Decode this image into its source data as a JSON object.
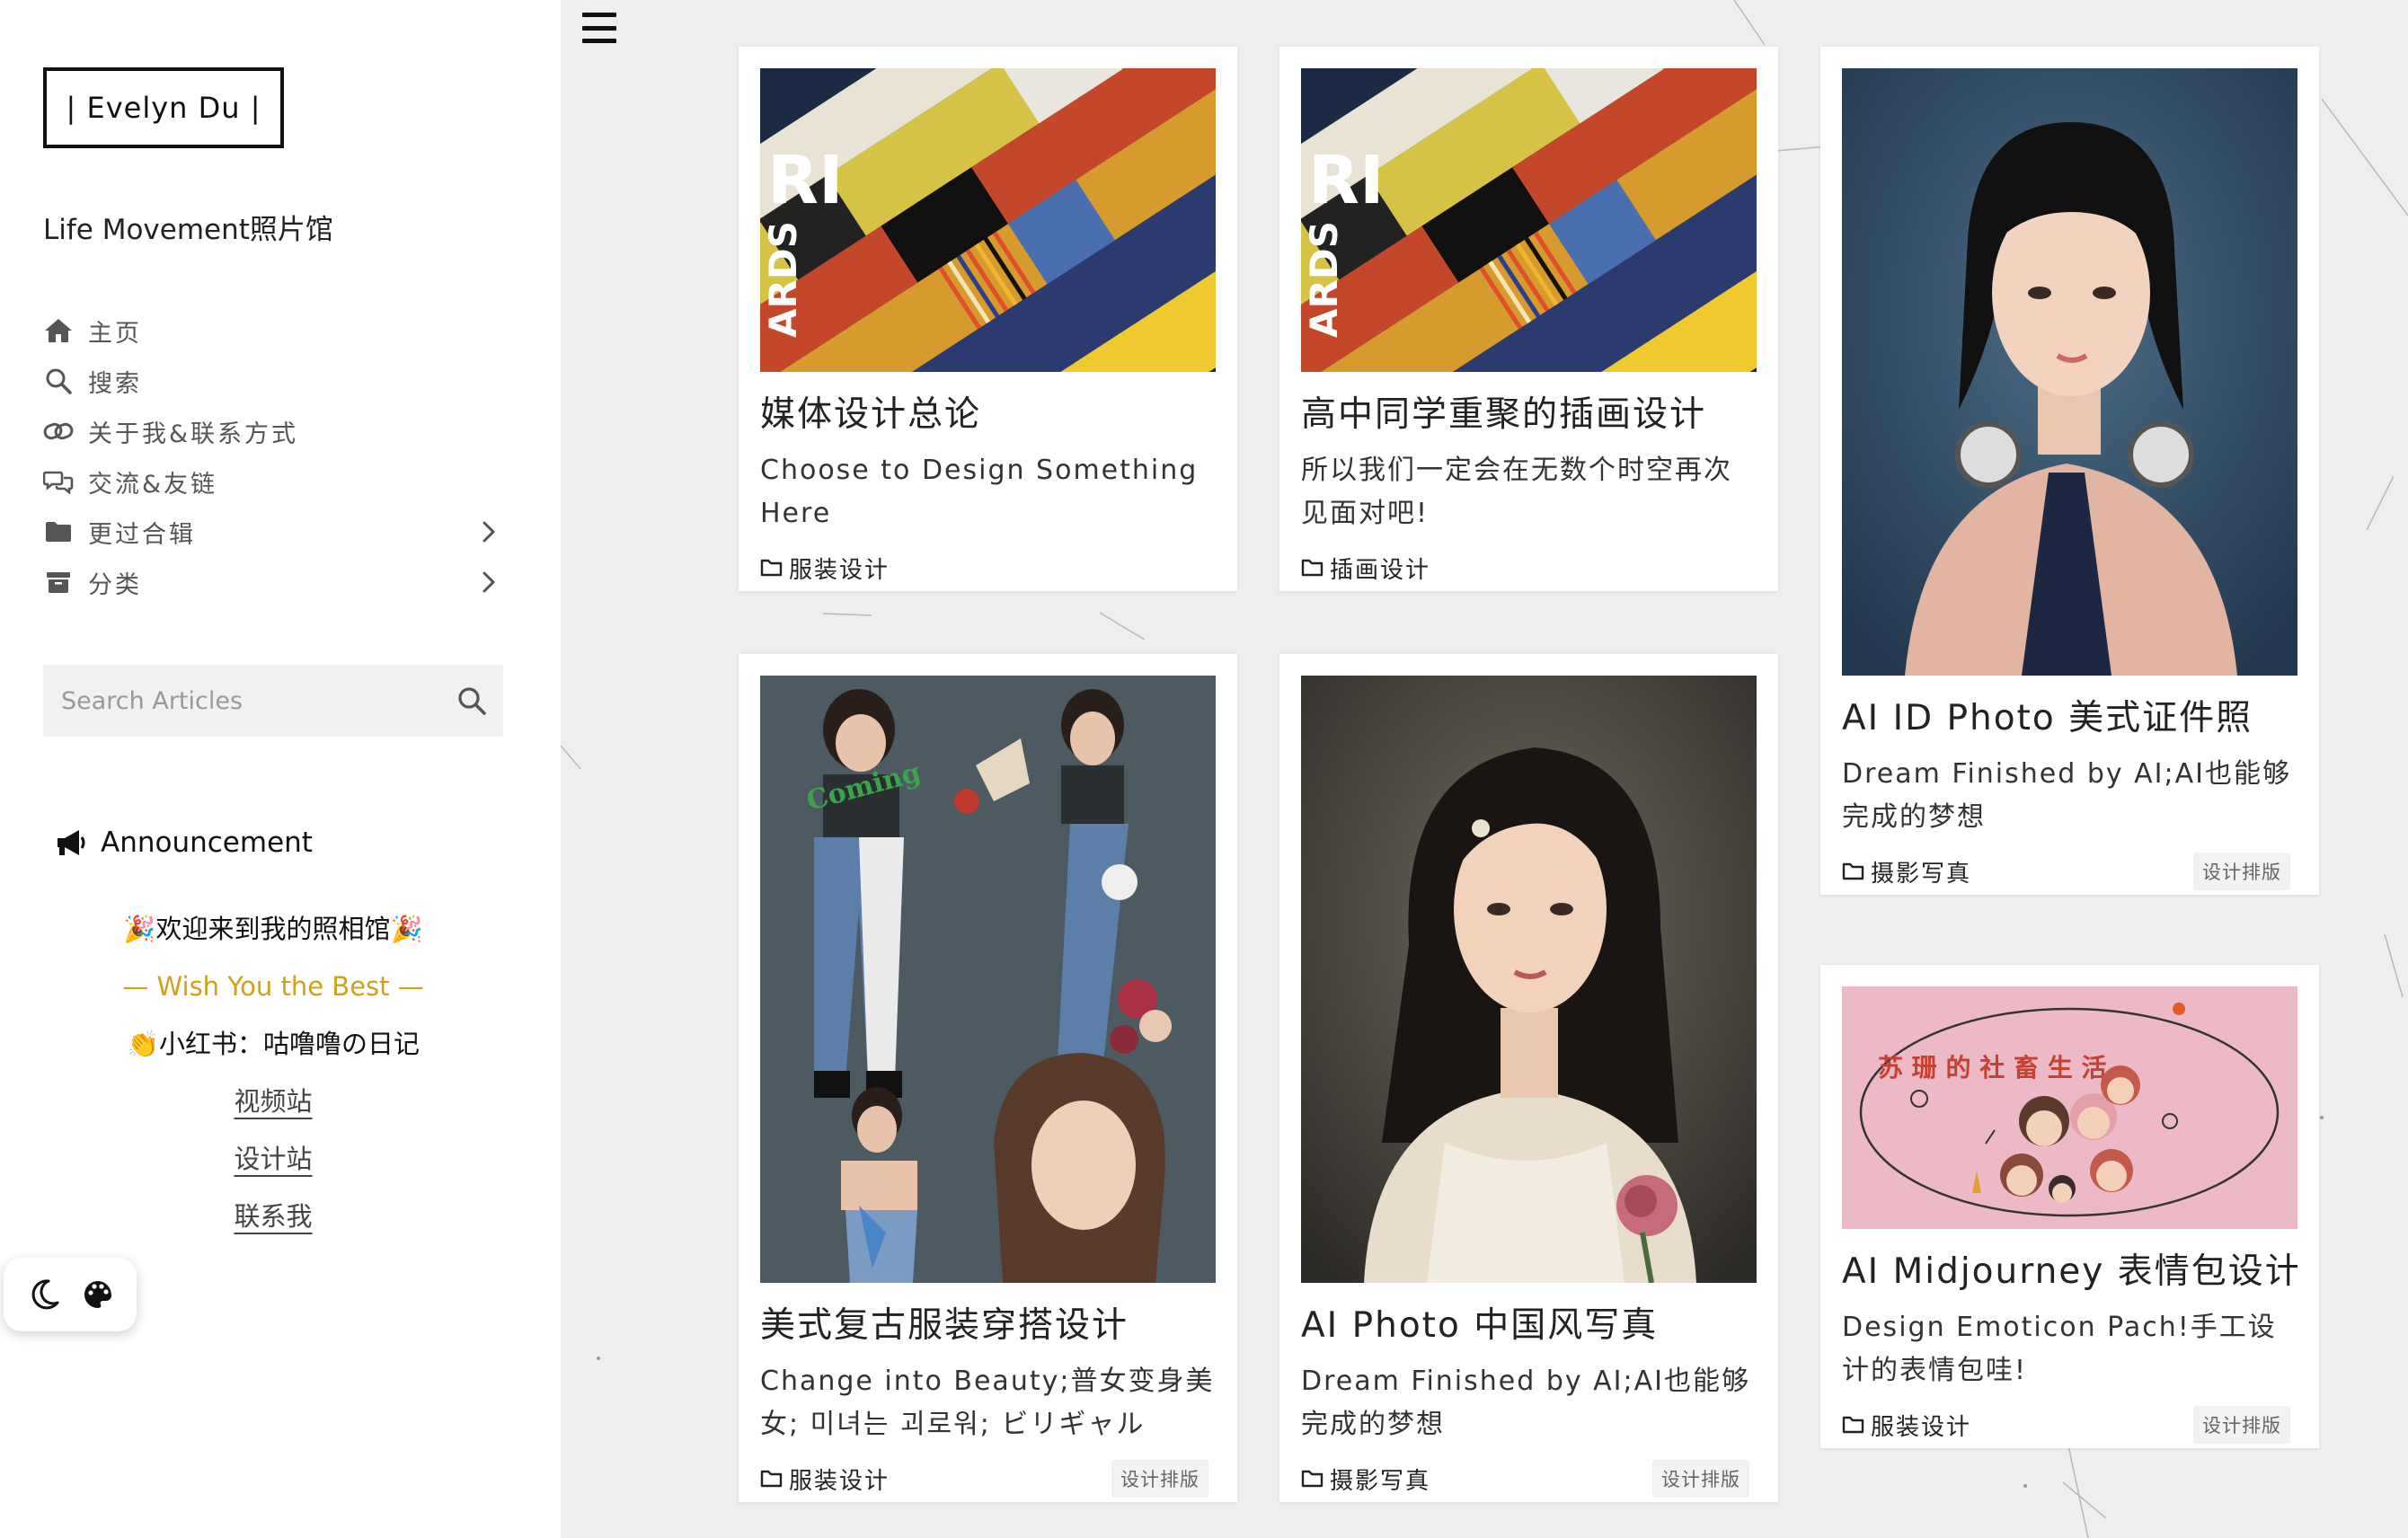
{
  "site": {
    "logo": "| Evelyn Du |",
    "subtitle": "Life Movement照片馆"
  },
  "menu": [
    {
      "label": "主页",
      "icon": "home-icon"
    },
    {
      "label": "搜索",
      "icon": "search-icon"
    },
    {
      "label": "关于我&联系方式",
      "icon": "link-icon"
    },
    {
      "label": "交流&友链",
      "icon": "chat-icon"
    },
    {
      "label": "更过合辑",
      "icon": "folder-icon"
    },
    {
      "label": "分类",
      "icon": "archive-icon"
    }
  ],
  "search": {
    "placeholder": "Search Articles"
  },
  "announcement": {
    "title": "Announcement",
    "line1": "🎉欢迎来到我的照相馆🎉",
    "line2": "— Wish You the Best —",
    "line3": "👏小红书：咕噜噜の日记",
    "link1": "视频站",
    "link2": "设计站",
    "link3": "联系我"
  },
  "posts": [
    {
      "title": "媒体设计总论",
      "desc": "Choose to Design Something Here",
      "category": "服装设计",
      "tag": ""
    },
    {
      "title": "高中同学重聚的插画设计",
      "desc": "所以我们一定会在无数个时空再次见面对吧!",
      "category": "插画设计",
      "tag": ""
    },
    {
      "title": "AI ID Photo 美式证件照",
      "desc": "Dream Finished by AI;AI也能够完成的梦想",
      "category": "摄影写真",
      "tag": "设计排版"
    },
    {
      "title": "美式复古服装穿搭设计",
      "desc": "Change into Beauty;普女变身美女; 미녀는 괴로워; ビリギャル",
      "category": "服装设计",
      "tag": "设计排版"
    },
    {
      "title": "AI Photo 中国风写真",
      "desc": "Dream Finished by AI;AI也能够完成的梦想",
      "category": "摄影写真",
      "tag": "设计排版"
    },
    {
      "title": "AI Midjourney 表情包设计",
      "desc": "Design Emoticon Pach!手工设计的表情包哇!",
      "category": "服装设计",
      "tag": "设计排版"
    }
  ],
  "graphics": {
    "collage_text": "Coming",
    "doodle_text": "苏 珊 的 社 畜 生 活"
  },
  "colors": {
    "accent_gold": "#d4a017",
    "sidebar_bg": "#ffffff",
    "page_bg": "#eeeeee"
  }
}
